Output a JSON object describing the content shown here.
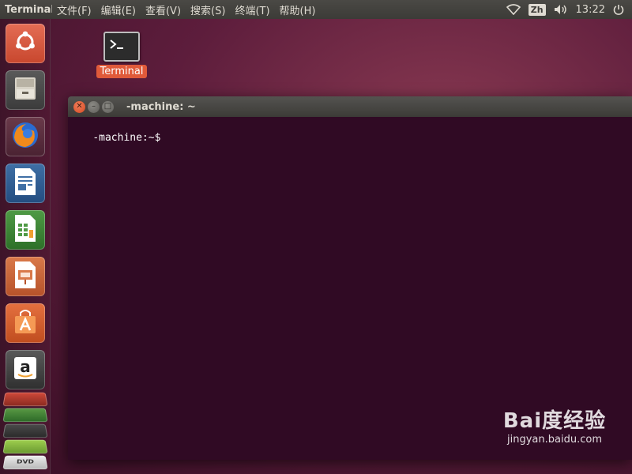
{
  "top_panel": {
    "app_title": "Terminal",
    "menu": [
      {
        "label": "文件(F)"
      },
      {
        "label": "编辑(E)"
      },
      {
        "label": "查看(V)"
      },
      {
        "label": "搜索(S)"
      },
      {
        "label": "终端(T)"
      },
      {
        "label": "帮助(H)"
      }
    ],
    "input_method": "Zh",
    "clock": "13:22",
    "indicator_icons": [
      "wifi-icon",
      "volume-icon",
      "power-icon"
    ]
  },
  "launcher": {
    "items": [
      {
        "name": "ubuntu-dash",
        "icon": "ubuntu-logo-icon"
      },
      {
        "name": "files",
        "icon": "file-cabinet-icon"
      },
      {
        "name": "firefox",
        "icon": "firefox-icon"
      },
      {
        "name": "libreoffice-writer",
        "icon": "document-icon"
      },
      {
        "name": "libreoffice-calc",
        "icon": "spreadsheet-icon"
      },
      {
        "name": "libreoffice-impress",
        "icon": "presentation-icon"
      },
      {
        "name": "software-center",
        "icon": "shopping-bag-icon"
      },
      {
        "name": "amazon",
        "icon": "amazon-icon"
      }
    ],
    "stack_label": "DVD"
  },
  "desktop": {
    "icon_label": "Terminal"
  },
  "terminal": {
    "title": "-machine: ~",
    "prompt": "-machine:~$"
  },
  "watermark": {
    "main": "Bai度经验",
    "url": "jingyan.baidu.com"
  },
  "colors": {
    "terminal_bg": "#300a24",
    "accent": "#e05a3a",
    "panel_bg": "#3c3b37"
  }
}
